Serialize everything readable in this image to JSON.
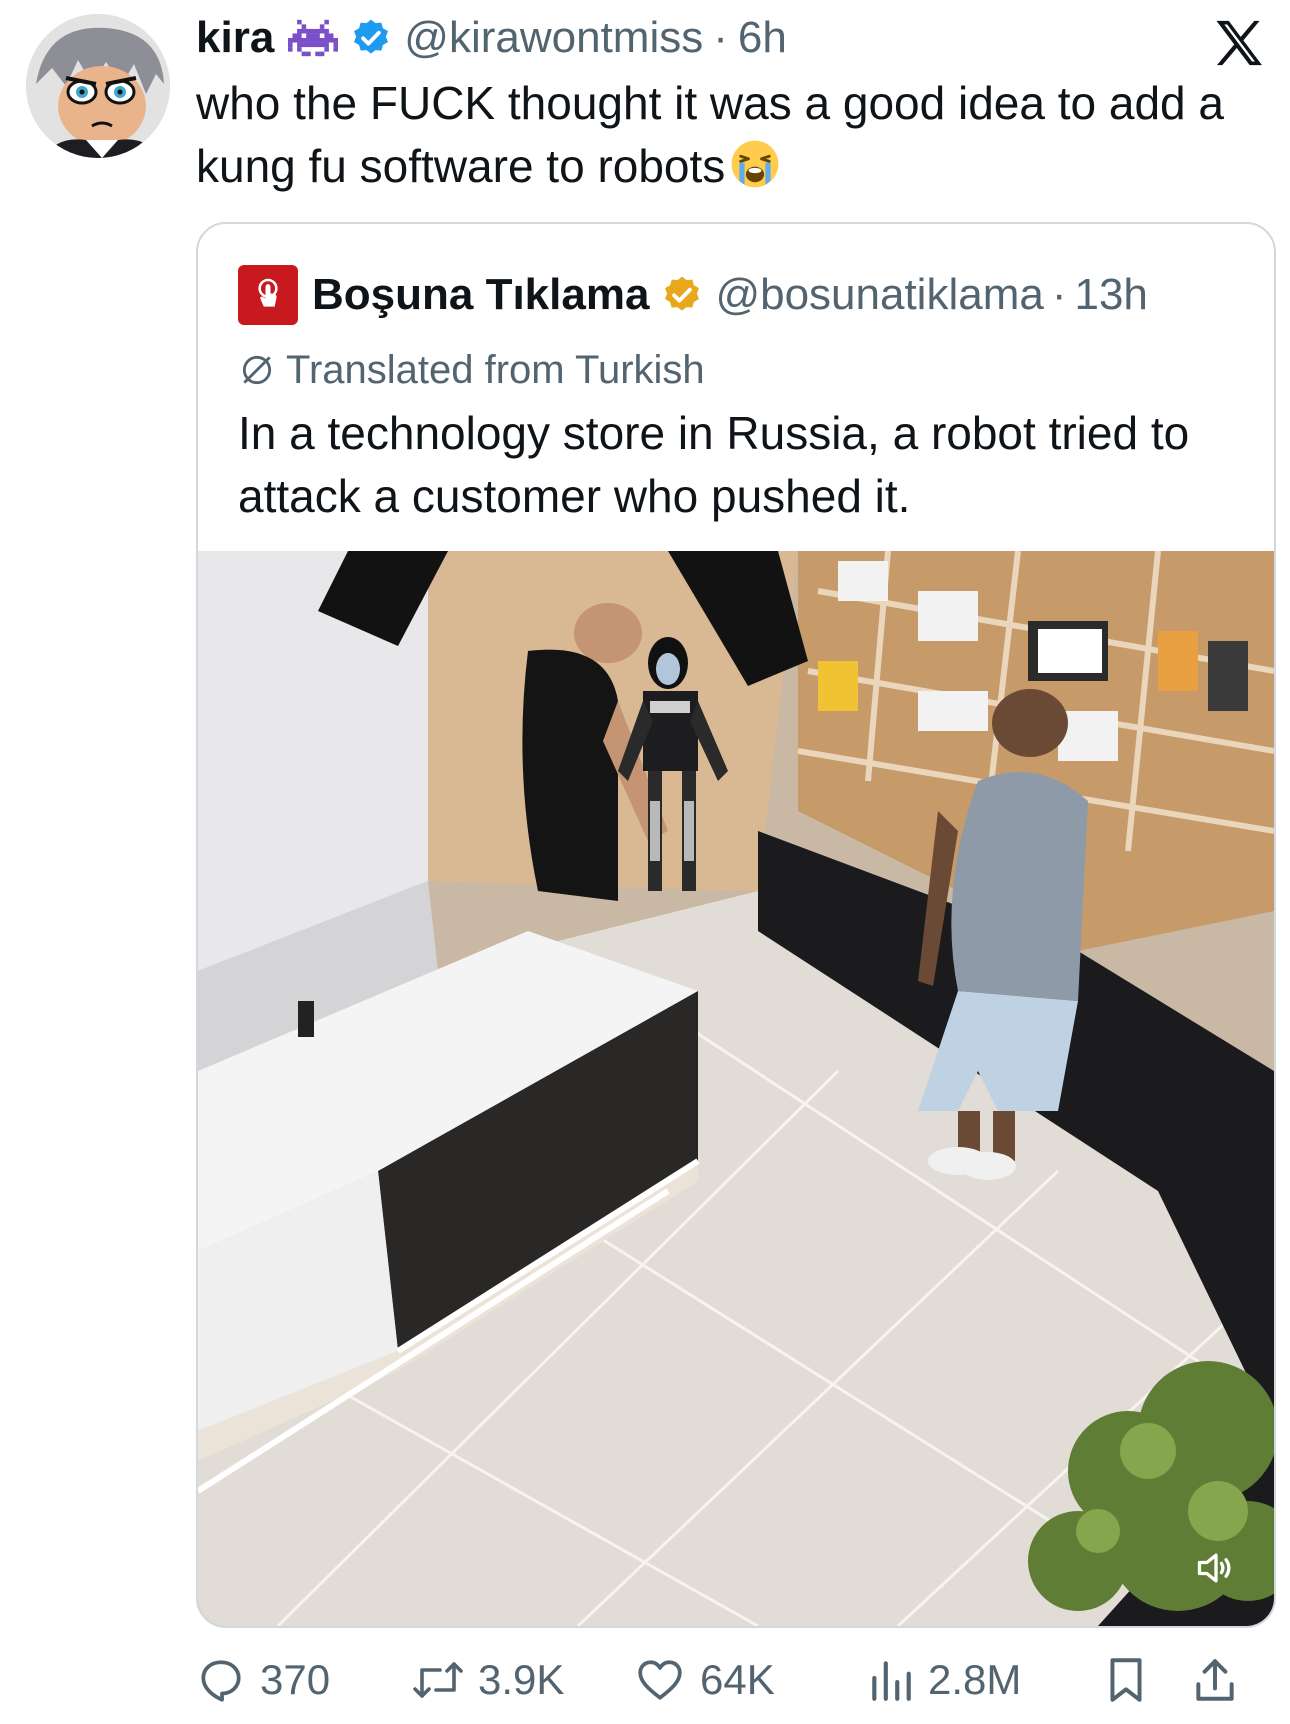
{
  "author": {
    "display_name": "kira",
    "handle": "@kirawontmiss",
    "separator": "·",
    "time": "6h",
    "name_emoji": "alien-monster-emoji",
    "verified_color": "#1d9bf0"
  },
  "tweet": {
    "text": "who the FUCK thought it was a good idea to add a kung fu software to robots",
    "emoji": "loudly-crying-face-emoji"
  },
  "quoted": {
    "display_name": "Boşuna Tıklama",
    "handle": "@bosunatiklama",
    "separator": "·",
    "time": "13h",
    "translated_label": "Translated from Turkish",
    "text": "In a technology store in Russia, a robot tried to attack a customer who pushed it.",
    "badge_color": "#e8a81c",
    "logo_color": "#c8191e"
  },
  "media": {
    "type": "video",
    "muted_icon": "speaker-muted-icon"
  },
  "actions": {
    "replies": "370",
    "reposts": "3.9K",
    "likes": "64K",
    "views": "2.8M"
  },
  "colors": {
    "text_primary": "#0f1419",
    "text_secondary": "#536471",
    "border": "#cfd9de"
  }
}
